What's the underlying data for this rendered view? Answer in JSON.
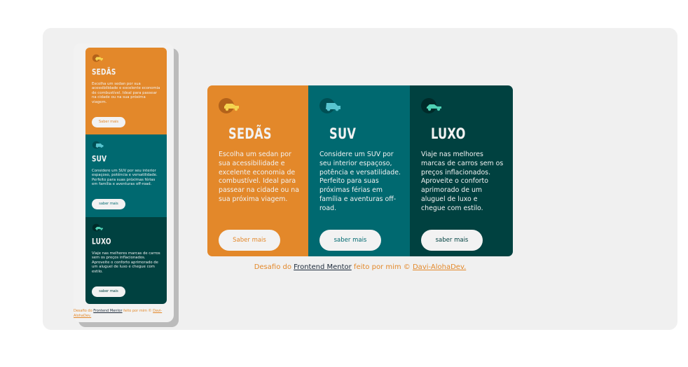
{
  "colors": {
    "orange": "#e3882a",
    "teal": "#006970",
    "dark_teal": "#004140",
    "background": "#f0f0f0",
    "text_light": "#f2f2f2"
  },
  "cards": [
    {
      "icon": "sedan-car-icon",
      "title": "SEDÃS",
      "text": "Escolha um sedan por sua acessibilidade e excelente economia de combustível. Ideal para passear na cidade ou na sua próxima viagem.",
      "button": "Saber mais"
    },
    {
      "icon": "suv-car-icon",
      "title": "SUV",
      "text": "Considere um SUV por seu interior espaçoso, potência e versatilidade. Perfeito para suas próximas férias em família e aventuras off-road.",
      "button": "saber mais"
    },
    {
      "icon": "luxury-car-icon",
      "title": "LUXO",
      "text": "Viaje nas melhores marcas de carros sem os preços inflacionados. Aproveite o conforto aprimorado de um aluguel de luxo e chegue com estilo.",
      "button": "saber mais"
    }
  ],
  "footer": {
    "prefix": "Desafio do",
    "link1": "Frontend Mentor",
    "middle": "feito por mim ©",
    "link2": "Davi-AlohaDev."
  }
}
